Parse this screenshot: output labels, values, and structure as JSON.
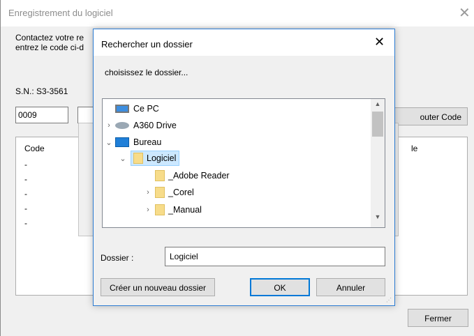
{
  "background_window": {
    "title": "Enregistrement  du logiciel",
    "close_glyph": "✕",
    "contact_text": "Contactez votre re\nentrez le code ci-d",
    "serial_label": "S.N.: S3-3561",
    "code_value": "0009",
    "add_code_label": "outer Code",
    "list_header_code": "Code",
    "list_header_right": "le",
    "list_dashes": [
      "-",
      "-",
      "-",
      "-",
      "-"
    ],
    "close_button": "Fermer"
  },
  "dialog": {
    "title": "Rechercher un dossier",
    "close_glyph": "✕",
    "prompt": "choisissez le dossier...",
    "tree": [
      {
        "label": "Ce PC",
        "icon": "computer-icon",
        "chevron": ""
      },
      {
        "label": "A360 Drive",
        "icon": "cloud-drive-icon",
        "chevron": "›"
      },
      {
        "label": "Bureau",
        "icon": "desktop-icon",
        "chevron": "⌄"
      },
      {
        "label": "Logiciel",
        "icon": "folder-icon",
        "chevron": "⌄",
        "selected": true
      },
      {
        "label": "_Adobe Reader",
        "icon": "folder-icon",
        "chevron": ""
      },
      {
        "label": "_Corel",
        "icon": "folder-icon",
        "chevron": "›"
      },
      {
        "label": "_Manual",
        "icon": "folder-icon",
        "chevron": "›"
      }
    ],
    "folder_label": "Dossier :",
    "folder_value": "Logiciel",
    "new_folder_button": "Créer un nouveau dossier",
    "ok_button": "OK",
    "cancel_button": "Annuler",
    "scroll_up_glyph": "▲",
    "scroll_down_glyph": "▼"
  },
  "colors": {
    "accent": "#0078d7",
    "selection": "#cce8ff"
  }
}
